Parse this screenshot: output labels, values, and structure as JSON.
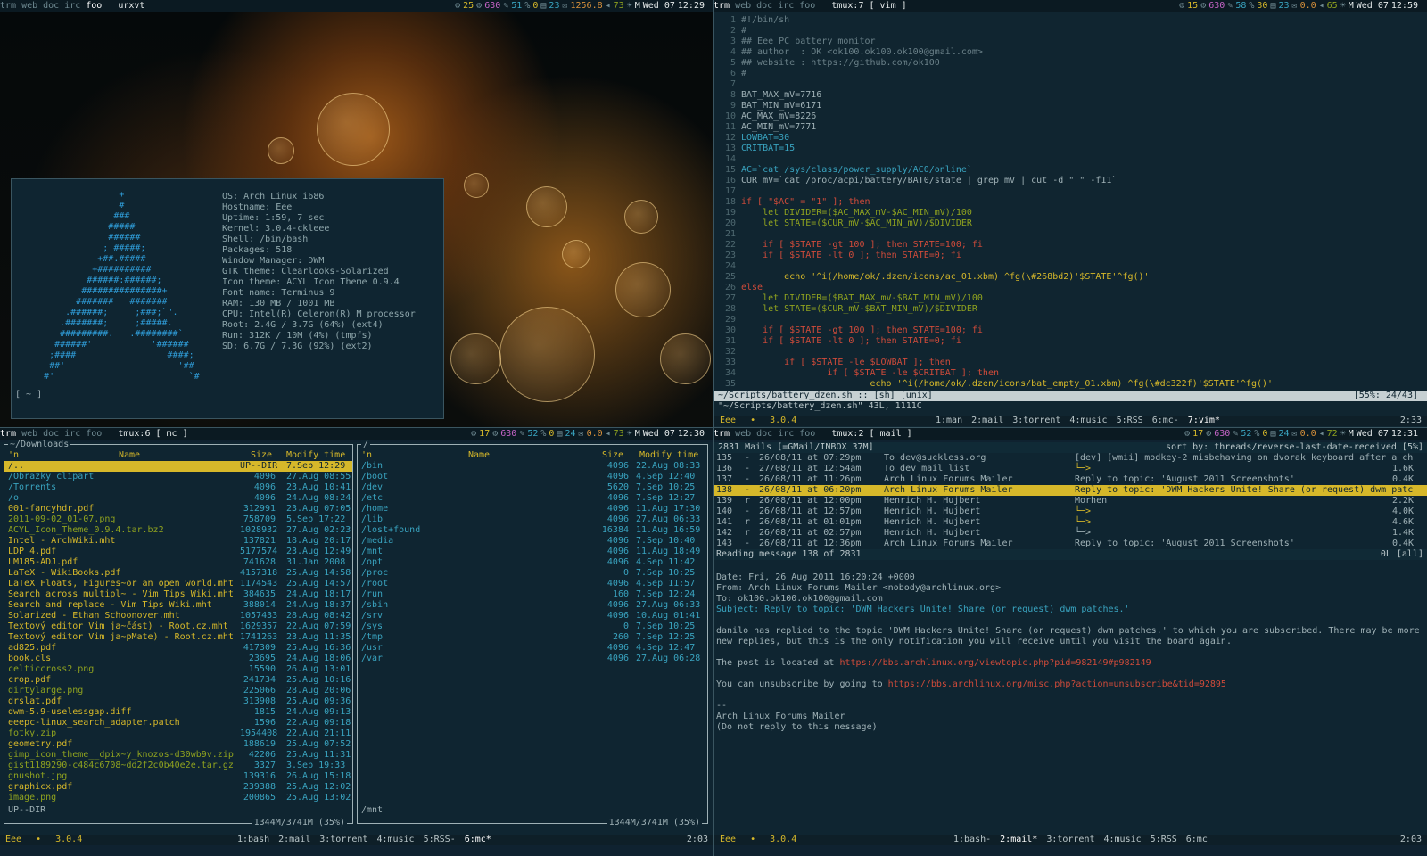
{
  "tl_bar": {
    "tags": [
      "trm",
      "web",
      "doc",
      "irc",
      "foo"
    ],
    "active_tag": "foo",
    "title": "urxvt",
    "stats": [
      "25",
      "630",
      "51",
      "0",
      "23",
      "1256.8",
      "73",
      "M"
    ],
    "date": "Wed 07",
    "time": "12:29"
  },
  "tr_bar": {
    "tags": [
      "trm",
      "web",
      "doc",
      "irc",
      "foo"
    ],
    "active_tag": "trm",
    "title": "tmux:7 [ vim ]",
    "stats": [
      "15",
      "630",
      "58",
      "30",
      "23",
      "0.0",
      "65",
      "M"
    ],
    "date": "Wed 07",
    "time": "12:59"
  },
  "bl_bar": {
    "tags": [
      "trm",
      "web",
      "doc",
      "irc",
      "foo"
    ],
    "active_tag": "trm",
    "title": "tmux:6 [ mc ]",
    "stats": [
      "17",
      "630",
      "52",
      "0",
      "24",
      "0.0",
      "73",
      "M"
    ],
    "date": "Wed 07",
    "time": "12:30"
  },
  "br_bar": {
    "tags": [
      "trm",
      "web",
      "doc",
      "irc",
      "foo"
    ],
    "active_tag": "trm",
    "title": "tmux:2 [ mail ]",
    "stats": [
      "17",
      "630",
      "52",
      "0",
      "24",
      "0.0",
      "72",
      "M"
    ],
    "date": "Wed 07",
    "time": "12:31"
  },
  "fetch": {
    "logo": "                 +\n                 #\n                ###\n               #####\n               ######\n              ; #####;\n             +##.#####\n            +##########\n           ######:######;\n          ###############+\n         #######   #######\n       .######;     ;###;`\".\n      .#######;     ;#####.\n      #########.   .########`\n     ######'           '######\n    ;####                 ####;\n    ##'                     '##\n   #'                         `#",
    "lines": [
      "OS: Arch Linux i686",
      "Hostname: Eee",
      "Uptime: 1:59, 7 sec",
      "Kernel: 3.0.4-ckleee",
      "Shell: /bin/bash",
      "Packages: 518",
      "Window Manager: DWM",
      "GTK theme: Clearlooks-Solarized",
      "Icon theme: ACYL Icon Theme 0.9.4",
      "Font name: Terminus 9",
      "RAM: 130 MB / 1001 MB",
      "CPU: Intel(R) Celeron(R) M processor",
      "Root: 2.4G / 3.7G (64%) (ext4)",
      "Run: 312K / 10M (4%) (tmpfs)",
      "SD: 6.7G / 7.3G (92%) (ext2)"
    ],
    "prompt": "[ ~ ]"
  },
  "vim": {
    "code": [
      "#!/bin/sh",
      "#",
      "## Eee PC battery monitor",
      "## author  : OK <ok100.ok100.ok100@gmail.com>",
      "## website : https://github.com/ok100",
      "#",
      "",
      "BAT_MAX_mV=7716",
      "BAT_MIN_mV=6171",
      "AC_MAX_mV=8226",
      "AC_MIN_mV=7771",
      "LOWBAT=30",
      "CRITBAT=15",
      "",
      "AC=`cat /sys/class/power_supply/AC0/online`",
      "CUR_mV=`cat /proc/acpi/battery/BAT0/state | grep mV | cut -d \" \" -f11`",
      "",
      "if [ \"$AC\" = \"1\" ]; then",
      "    let DIVIDER=($AC_MAX_mV-$AC_MIN_mV)/100",
      "    let STATE=($CUR_mV-$AC_MIN_mV)/$DIVIDER",
      "",
      "    if [ $STATE -gt 100 ]; then STATE=100; fi",
      "    if [ $STATE -lt 0 ]; then STATE=0; fi",
      "",
      "        echo '^i(/home/ok/.dzen/icons/ac_01.xbm) ^fg(\\#268bd2)'$STATE'^fg()'",
      "else",
      "    let DIVIDER=($BAT_MAX_mV-$BAT_MIN_mV)/100",
      "    let STATE=($CUR_mV-$BAT_MIN_mV)/$DIVIDER",
      "",
      "    if [ $STATE -gt 100 ]; then STATE=100; fi",
      "    if [ $STATE -lt 0 ]; then STATE=0; fi",
      "",
      "        if [ $STATE -le $LOWBAT ]; then",
      "                if [ $STATE -le $CRITBAT ]; then",
      "                        echo '^i(/home/ok/.dzen/icons/bat_empty_01.xbm) ^fg(\\#dc322f)'$STATE'^fg()'"
    ],
    "statusline_left": "~/Scripts/battery_dzen.sh :: [sh] [unix]",
    "statusline_right": "[55%: 24/43]",
    "cmdline": "\"~/Scripts/battery_dzen.sh\" 43L, 1111C"
  },
  "tmux_top": {
    "host": "Eee",
    "version": "3.0.4",
    "windows": [
      "1:man",
      "2:mail",
      "3:torrent",
      "4:music",
      "5:RSS",
      "6:mc-",
      "7:vim*"
    ],
    "clock": "2:33"
  },
  "mc": {
    "left_path": "~/Downloads",
    "right_path": "/",
    "col_n": "'n",
    "col_name": "Name",
    "col_size": "Size",
    "col_time": "Modify time",
    "left": [
      [
        "/..",
        "UP--DIR",
        "7.Sep 12:29"
      ],
      [
        "/Obrazky_clipart",
        "4096",
        "27.Aug 08:55"
      ],
      [
        "/Torrents",
        "4096",
        "23.Aug 10:41"
      ],
      [
        "/o",
        "4096",
        "24.Aug 08:24"
      ],
      [
        "001-fancyhdr.pdf",
        "312991",
        "23.Aug 07:05"
      ],
      [
        "2011-09-02_01-07.png",
        "758709",
        "5.Sep 17:22"
      ],
      [
        "ACYL_Icon_Theme_0.9.4.tar.bz2",
        "1028932",
        "27.Aug 02:23"
      ],
      [
        "Intel - ArchWiki.mht",
        "137821",
        "18.Aug 20:17"
      ],
      [
        "LDP_4.pdf",
        "5177574",
        "23.Aug 12:49"
      ],
      [
        "LM185-ADJ.pdf",
        "741628",
        "31.Jan 2008"
      ],
      [
        "LaTeX - WikiBooks.pdf",
        "4157318",
        "25.Aug 14:58"
      ],
      [
        "LaTeX_Floats, Figures~or an open world.mht",
        "1174543",
        "25.Aug 14:57"
      ],
      [
        "Search across multipl~ - Vim Tips Wiki.mht",
        "384635",
        "24.Aug 18:17"
      ],
      [
        "Search and replace - Vim Tips Wiki.mht",
        "388014",
        "24.Aug 18:37"
      ],
      [
        "Solarized - Ethan Schoonover.mht",
        "1057433",
        "28.Aug 08:42"
      ],
      [
        "Textový editor Vim ja~část) - Root.cz.mht",
        "1629357",
        "22.Aug 07:59"
      ],
      [
        "Textový editor Vim ja~pMate) - Root.cz.mht",
        "1741263",
        "23.Aug 11:35"
      ],
      [
        "ad825.pdf",
        "417309",
        "25.Aug 16:36"
      ],
      [
        "book.cls",
        "23695",
        "24.Aug 18:06"
      ],
      [
        "celticcross2.png",
        "15590",
        "26.Aug 13:01"
      ],
      [
        "crop.pdf",
        "241734",
        "25.Aug 10:16"
      ],
      [
        "dirtylarge.png",
        "225066",
        "28.Aug 20:06"
      ],
      [
        "drslat.pdf",
        "313908",
        "25.Aug 09:36"
      ],
      [
        "dwm-5.9-uselessgap.diff",
        "1815",
        "24.Aug 09:13"
      ],
      [
        "eeepc-linux_search_adapter.patch",
        "1596",
        "22.Aug 09:18"
      ],
      [
        "fotky.zip",
        "1954408",
        "22.Aug 21:11"
      ],
      [
        "geometry.pdf",
        "188619",
        "25.Aug 07:52"
      ],
      [
        "gimp_icon_theme__dpix~y_knozos-d30wb9v.zip",
        "42206",
        "25.Aug 11:31"
      ],
      [
        "gist1189290-c484c6708~dd2f2c0b40e2e.tar.gz",
        "3327",
        "3.Sep 19:33"
      ],
      [
        "gnushot.jpg",
        "139316",
        "26.Aug 15:18"
      ],
      [
        "graphicx.pdf",
        "239388",
        "25.Aug 12:02"
      ],
      [
        "image.png",
        "200865",
        "25.Aug 13:02"
      ]
    ],
    "right": [
      [
        "/bin",
        "4096",
        "22.Aug 08:33"
      ],
      [
        "/boot",
        "4096",
        "4.Sep 12:40"
      ],
      [
        "/dev",
        "5620",
        "7.Sep 10:25"
      ],
      [
        "/etc",
        "4096",
        "7.Sep 12:27"
      ],
      [
        "/home",
        "4096",
        "11.Aug 17:30"
      ],
      [
        "/lib",
        "4096",
        "27.Aug 06:33"
      ],
      [
        "/lost+found",
        "16384",
        "11.Aug 16:59"
      ],
      [
        "/media",
        "4096",
        "7.Sep 10:40"
      ],
      [
        "/mnt",
        "4096",
        "11.Aug 18:49"
      ],
      [
        "/opt",
        "4096",
        "4.Sep 11:42"
      ],
      [
        "/proc",
        "0",
        "7.Sep 10:25"
      ],
      [
        "/root",
        "4096",
        "4.Sep 11:57"
      ],
      [
        "/run",
        "160",
        "7.Sep 12:24"
      ],
      [
        "/sbin",
        "4096",
        "27.Aug 06:33"
      ],
      [
        "/srv",
        "4096",
        "10.Aug 01:41"
      ],
      [
        "/sys",
        "0",
        "7.Sep 10:25"
      ],
      [
        "/tmp",
        "260",
        "7.Sep 12:25"
      ],
      [
        "/usr",
        "4096",
        "4.Sep 12:47"
      ],
      [
        "/var",
        "4096",
        "27.Aug 06:28"
      ]
    ],
    "left_status": "UP--DIR",
    "right_status": "/mnt",
    "disk": "1344M/3741M (35%)"
  },
  "tmux_bl": {
    "host": "Eee",
    "version": "3.0.4",
    "windows": [
      "1:bash",
      "2:mail",
      "3:torrent",
      "4:music",
      "5:RSS-",
      "6:mc*"
    ],
    "clock": "2:03"
  },
  "mutt": {
    "header_left": "2831 Mails [=GMail/INBOX 37M]",
    "header_right": "sort by: threads/reverse-last-date-received  [5%]",
    "rows": [
      [
        "135",
        "-",
        "26/08/11 at 07:29pm",
        "To dev@suckless.org",
        "[dev] [wmii] modkey-2 misbehaving on dvorak keyboard after a ch",
        ""
      ],
      [
        "136",
        "-",
        "27/08/11 at 12:54am",
        "To dev mail list",
        "└─>",
        "1.6K"
      ],
      [
        "137",
        "-",
        "26/08/11 at 11:26pm",
        "Arch Linux Forums Mailer",
        "Reply to topic: 'August 2011 Screenshots'",
        "0.4K"
      ],
      [
        "138",
        "-",
        "26/08/11 at 06:20pm",
        "Arch Linux Forums Mailer",
        "Reply to topic: 'DWM Hackers Unite! Share (or request) dwm patc",
        ""
      ],
      [
        "139",
        "r",
        "26/08/11 at 12:00pm",
        "Henrich H. Hujbert",
        "Morhen",
        "2.2K"
      ],
      [
        "140",
        "-",
        "26/08/11 at 12:57pm",
        "Henrich H. Hujbert",
        "└─>",
        "4.0K"
      ],
      [
        "141",
        "r",
        "26/08/11 at 01:01pm",
        "Henrich H. Hujbert",
        "  └─>",
        "4.6K"
      ],
      [
        "142",
        "r",
        "26/08/11 at 02:57pm",
        "Henrich H. Hujbert",
        "    └─>",
        "1.4K"
      ],
      [
        "143",
        "-",
        "26/08/11 at 12:36pm",
        "Arch Linux Forums Mailer",
        "Reply to topic: 'August 2011 Screenshots'",
        "0.4K"
      ]
    ],
    "reading": "Reading message 138 of 2831",
    "reading_right": "0L [all]",
    "date": "Date: Fri, 26 Aug 2011 16:20:24 +0000",
    "from": "From: Arch Linux Forums Mailer <nobody@archlinux.org>",
    "to": "To: ok100.ok100.ok100@gmail.com",
    "subject": "Subject: Reply to topic: 'DWM Hackers Unite! Share (or request) dwm patches.'",
    "body1": "danilo has replied to the topic 'DWM Hackers Unite! Share (or request) dwm patches.' to which you are subscribed. There may be more\nnew replies, but this is the only notification you will receive until you visit the board again.",
    "body2_prefix": "The post is located at ",
    "body2_link": "https://bbs.archlinux.org/viewtopic.php?pid=982149#p982149",
    "body3_prefix": "You can unsubscribe by going to ",
    "body3_link": "https://bbs.archlinux.org/misc.php?action=unsubscribe&tid=92895",
    "sig": "--\nArch Linux Forums Mailer\n(Do not reply to this message)"
  },
  "tmux_br": {
    "host": "Eee",
    "version": "3.0.4",
    "windows": [
      "1:bash-",
      "2:mail*",
      "3:torrent",
      "4:music",
      "5:RSS",
      "6:mc"
    ],
    "clock": "2:03"
  },
  "colors": {
    "accent": "#d6b82a",
    "bg": "#0f2531",
    "dir": "#39a3bf",
    "file": "#d6b82a",
    "link": "#d04b3a"
  }
}
